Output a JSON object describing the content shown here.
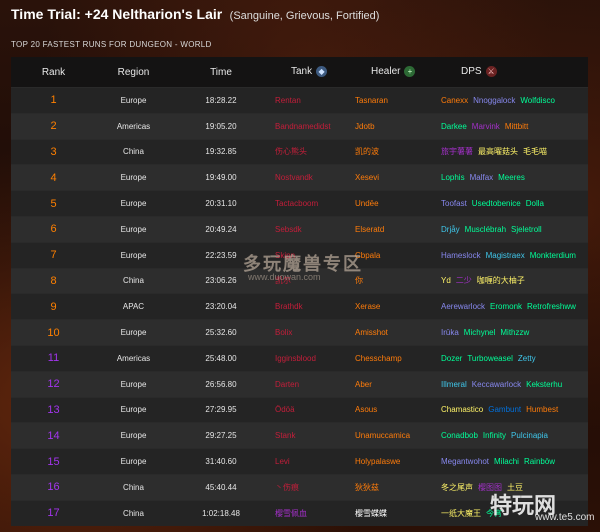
{
  "header": {
    "title": "Time Trial: +24 Neltharion's Lair",
    "affixes": "(Sanguine, Grievous, Fortified)",
    "subtitle": "TOP 20 FASTEST RUNS FOR DUNGEON - WORLD"
  },
  "columns": {
    "rank": "Rank",
    "region": "Region",
    "time": "Time",
    "tank": "Tank",
    "healer": "Healer",
    "dps": "DPS"
  },
  "icons": {
    "tank": "shield-icon",
    "healer": "plus-icon",
    "dps": "sword-icon"
  },
  "colors": {
    "rank_orange": "#ff8000",
    "rank_purple": "#a335ee",
    "dk": "#c41e3a",
    "dh": "#a330c9",
    "druid": "#ff7c0a",
    "hunter": "#aad372",
    "mage": "#3fc7eb",
    "monk": "#00ff98",
    "paladin": "#f48cba",
    "priest": "#ffffff",
    "rogue": "#fff468",
    "shaman": "#0070dd",
    "warlock": "#8788ee",
    "warrior": "#c69b6d"
  },
  "rows": [
    {
      "rank": "1",
      "region": "Europe",
      "time": "18:28.22",
      "tank": "Rentan",
      "tank_c": "#c41e3a",
      "healer": "Tasnaran",
      "healer_c": "#ff7c0a",
      "dps": [
        [
          "Canexx",
          "#ff7c0a"
        ],
        [
          "Nnoggalock",
          "#8788ee"
        ],
        [
          "Wolfdisco",
          "#00ff98"
        ]
      ]
    },
    {
      "rank": "2",
      "region": "Americas",
      "time": "19:05.20",
      "tank": "Bandnamedidst",
      "tank_c": "#c41e3a",
      "healer": "Jdotb",
      "healer_c": "#ff7c0a",
      "dps": [
        [
          "Darkee",
          "#00ff98"
        ],
        [
          "Marvink",
          "#a330c9"
        ],
        [
          "Mittbitt",
          "#ff7c0a"
        ]
      ]
    },
    {
      "rank": "3",
      "region": "China",
      "time": "19:32.85",
      "tank": "伤心熊头",
      "tank_c": "#c41e3a",
      "healer": "凯的波",
      "healer_c": "#ff7c0a",
      "dps": [
        [
          "旅宇薯薯",
          "#a330c9"
        ],
        [
          "最高曜菇头",
          "#fff468"
        ],
        [
          "毛毛喵",
          "#fff468"
        ]
      ]
    },
    {
      "rank": "4",
      "region": "Europe",
      "time": "19:49.00",
      "tank": "Nostvandk",
      "tank_c": "#c41e3a",
      "healer": "Xesevi",
      "healer_c": "#ff7c0a",
      "dps": [
        [
          "Lophis",
          "#00ff98"
        ],
        [
          "Malfax",
          "#8788ee"
        ],
        [
          "Meeres",
          "#00ff98"
        ]
      ]
    },
    {
      "rank": "5",
      "region": "Europe",
      "time": "20:31.10",
      "tank": "Tactacboom",
      "tank_c": "#c41e3a",
      "healer": "Undēe",
      "healer_c": "#ff7c0a",
      "dps": [
        [
          "Toofast",
          "#8788ee"
        ],
        [
          "Usedtobenice",
          "#00ff98"
        ],
        [
          "Dolla",
          "#00ff98"
        ]
      ]
    },
    {
      "rank": "6",
      "region": "Europe",
      "time": "20:49.24",
      "tank": "Sebsdk",
      "tank_c": "#c41e3a",
      "healer": "Elseratd",
      "healer_c": "#ff7c0a",
      "dps": [
        [
          "Drjåy",
          "#3fc7eb"
        ],
        [
          "Musclébrah",
          "#00ff98"
        ],
        [
          "Sjeletroll",
          "#00ff98"
        ]
      ]
    },
    {
      "rank": "7",
      "region": "Europe",
      "time": "22:23.59",
      "tank": "Skipn",
      "tank_c": "#c41e3a",
      "healer": "Cbpala",
      "healer_c": "#ff7c0a",
      "dps": [
        [
          "Hameslock",
          "#8788ee"
        ],
        [
          "Magistraex",
          "#3fc7eb"
        ],
        [
          "Monkterdium",
          "#00ff98"
        ]
      ]
    },
    {
      "rank": "8",
      "region": "China",
      "time": "23:06.26",
      "tank": "凯尔",
      "tank_c": "#c41e3a",
      "healer": "你",
      "healer_c": "#ff7c0a",
      "dps": [
        [
          "Yd",
          "#fff468"
        ],
        [
          "二少",
          "#a330c9"
        ],
        [
          "咖喱的大柚子",
          "#fff468"
        ]
      ]
    },
    {
      "rank": "9",
      "region": "APAC",
      "time": "23:20.04",
      "tank": "Brathdk",
      "tank_c": "#c41e3a",
      "healer": "Xerase",
      "healer_c": "#ff7c0a",
      "dps": [
        [
          "Aerewarlock",
          "#8788ee"
        ],
        [
          "Eromonk",
          "#00ff98"
        ],
        [
          "Retrofreshww",
          "#00ff98"
        ]
      ]
    },
    {
      "rank": "10",
      "region": "Europe",
      "time": "25:32.60",
      "tank": "Bolix",
      "tank_c": "#c41e3a",
      "healer": "Amisshot",
      "healer_c": "#ff7c0a",
      "dps": [
        [
          "Irūka",
          "#8788ee"
        ],
        [
          "Michynel",
          "#00ff98"
        ],
        [
          "Mithzzw",
          "#00ff98"
        ]
      ]
    },
    {
      "rank": "11",
      "region": "Americas",
      "time": "25:48.00",
      "tank": "Igginsblood",
      "tank_c": "#c41e3a",
      "healer": "Chesschamp",
      "healer_c": "#ff7c0a",
      "dps": [
        [
          "Dozer",
          "#00ff98"
        ],
        [
          "Turboweasel",
          "#00ff98"
        ],
        [
          "Zetty",
          "#3fc7eb"
        ]
      ]
    },
    {
      "rank": "12",
      "region": "Europe",
      "time": "26:56.80",
      "tank": "Darten",
      "tank_c": "#c41e3a",
      "healer": "Aber",
      "healer_c": "#ff7c0a",
      "dps": [
        [
          "Illmeral",
          "#3fc7eb"
        ],
        [
          "Keccawarlock",
          "#8788ee"
        ],
        [
          "Keksterhu",
          "#00ff98"
        ]
      ]
    },
    {
      "rank": "13",
      "region": "Europe",
      "time": "27:29.95",
      "tank": "Ödöä",
      "tank_c": "#c41e3a",
      "healer": "Asous",
      "healer_c": "#ff7c0a",
      "dps": [
        [
          "Chamastico",
          "#fff468"
        ],
        [
          "Gambunt",
          "#0070dd"
        ],
        [
          "Humbest",
          "#ff7c0a"
        ]
      ]
    },
    {
      "rank": "14",
      "region": "Europe",
      "time": "29:27.25",
      "tank": "Stank",
      "tank_c": "#c41e3a",
      "healer": "Unamuccamica",
      "healer_c": "#ff7c0a",
      "dps": [
        [
          "Conadbob",
          "#00ff98"
        ],
        [
          "Infinity",
          "#00ff98"
        ],
        [
          "Pulcinapia",
          "#3fc7eb"
        ]
      ]
    },
    {
      "rank": "15",
      "region": "Europe",
      "time": "31:40.60",
      "tank": "Levi",
      "tank_c": "#c41e3a",
      "healer": "Holypalaswe",
      "healer_c": "#ff7c0a",
      "dps": [
        [
          "Megantwohot",
          "#8788ee"
        ],
        [
          "Milachi",
          "#00ff98"
        ],
        [
          "Rainbōw",
          "#00ff98"
        ]
      ]
    },
    {
      "rank": "16",
      "region": "China",
      "time": "45:40.44",
      "tank": "丶伤痕",
      "tank_c": "#c41e3a",
      "healer": "狄狄兹",
      "healer_c": "#ff7c0a",
      "dps": [
        [
          "冬之尾声",
          "#fff468"
        ],
        [
          "樱图图",
          "#a330c9"
        ],
        [
          "土豆",
          "#fff468"
        ]
      ]
    },
    {
      "rank": "17",
      "region": "China",
      "time": "1:02:18.48",
      "tank": "樱雪佩血",
      "tank_c": "#a330c9",
      "healer": "樱雪蝶蝶",
      "healer_c": "#ffffff",
      "dps": [
        [
          "一纸大魔王",
          "#fff468"
        ],
        [
          "今宵",
          "#00ff98"
        ]
      ]
    }
  ],
  "watermarks": {
    "cn_site": "多玩魔兽专区",
    "cn_url": "www.duowan.com",
    "logo": "特玩网",
    "logo_url": "www.te5.com"
  }
}
